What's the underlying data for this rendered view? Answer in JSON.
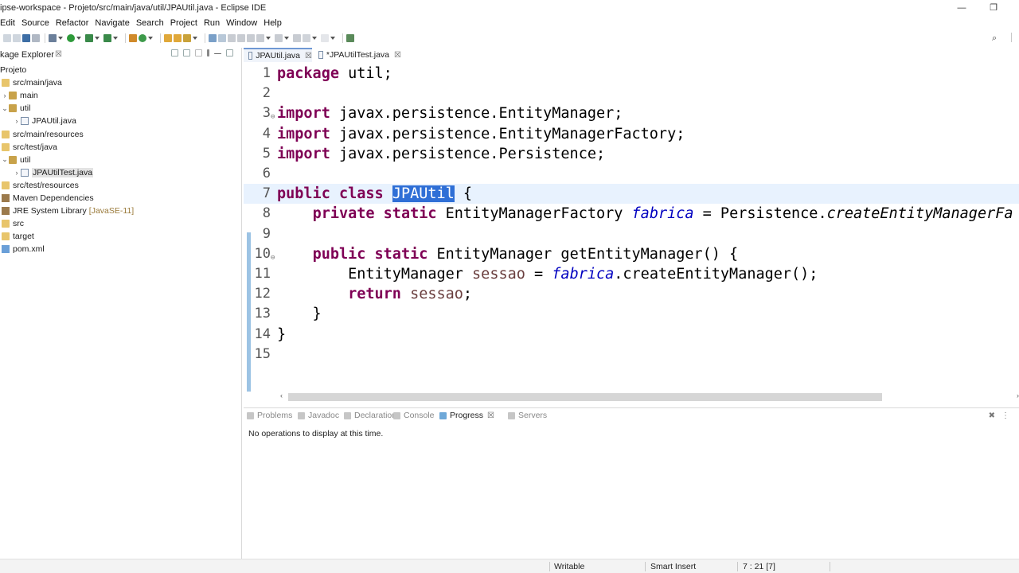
{
  "window": {
    "title": "ipse-workspace - Projeto/src/main/java/util/JPAUtil.java - Eclipse IDE",
    "minimize": "—",
    "restore": "❐"
  },
  "menu": [
    "Edit",
    "Source",
    "Refactor",
    "Navigate",
    "Search",
    "Project",
    "Run",
    "Window",
    "Help"
  ],
  "package_explorer": {
    "title": "kage Explorer",
    "close": "☒",
    "tree": [
      {
        "label": "Projeto",
        "indent": 0,
        "twisty": "",
        "icon": "proj"
      },
      {
        "label": "src/main/java",
        "indent": 1,
        "twisty": "",
        "icon": "folder"
      },
      {
        "label": "main",
        "indent": 2,
        "twisty": "›",
        "icon": "pkg"
      },
      {
        "label": "util",
        "indent": 2,
        "twisty": "⌄",
        "icon": "pkg"
      },
      {
        "label": "JPAUtil.java",
        "indent": 3,
        "twisty": "›",
        "icon": "java"
      },
      {
        "label": "src/main/resources",
        "indent": 1,
        "twisty": "",
        "icon": "folder"
      },
      {
        "label": "src/test/java",
        "indent": 1,
        "twisty": "",
        "icon": "folder"
      },
      {
        "label": "util",
        "indent": 2,
        "twisty": "⌄",
        "icon": "pkg"
      },
      {
        "label": "JPAUtilTest.java",
        "indent": 3,
        "twisty": "›",
        "icon": "java",
        "selected": true
      },
      {
        "label": "src/test/resources",
        "indent": 1,
        "twisty": "",
        "icon": "folder"
      },
      {
        "label": "Maven Dependencies",
        "indent": 1,
        "twisty": "",
        "icon": "lib"
      },
      {
        "label": "JRE System Library",
        "suffix": "[JavaSE-11]",
        "indent": 1,
        "twisty": "",
        "icon": "lib"
      },
      {
        "label": "src",
        "indent": 1,
        "twisty": "",
        "icon": "folder"
      },
      {
        "label": "target",
        "indent": 1,
        "twisty": "",
        "icon": "folder"
      },
      {
        "label": "pom.xml",
        "indent": 1,
        "twisty": "",
        "icon": "xml"
      }
    ]
  },
  "editor": {
    "tabs": [
      {
        "label": "JPAUtil.java",
        "close": "☒",
        "active": true
      },
      {
        "label": "*JPAUtilTest.java",
        "close": "☒",
        "active": false
      }
    ],
    "current_line": 7,
    "selection": "JPAUtil",
    "lines": [
      {
        "n": "1",
        "code": "package util;"
      },
      {
        "n": "2",
        "code": ""
      },
      {
        "n": "3",
        "code": "import javax.persistence.EntityManager;",
        "fold": true
      },
      {
        "n": "4",
        "code": "import javax.persistence.EntityManagerFactory;"
      },
      {
        "n": "5",
        "code": "import javax.persistence.Persistence;"
      },
      {
        "n": "6",
        "code": ""
      },
      {
        "n": "7",
        "code": "public class JPAUtil {"
      },
      {
        "n": "8",
        "code": "    private static EntityManagerFactory fabrica = Persistence.createEntityManagerFa"
      },
      {
        "n": "9",
        "code": ""
      },
      {
        "n": "10",
        "code": "    public static EntityManager getEntityManager() {",
        "fold": true
      },
      {
        "n": "11",
        "code": "        EntityManager sessao = fabrica.createEntityManager();"
      },
      {
        "n": "12",
        "code": "        return sessao;"
      },
      {
        "n": "13",
        "code": "    }"
      },
      {
        "n": "14",
        "code": "}"
      },
      {
        "n": "15",
        "code": ""
      }
    ]
  },
  "bottom_panel": {
    "tabs": [
      {
        "label": "Problems",
        "active": false
      },
      {
        "label": "Javadoc",
        "active": false
      },
      {
        "label": "Declaration",
        "active": false
      },
      {
        "label": "Console",
        "active": false
      },
      {
        "label": "Progress",
        "active": true,
        "close": "☒"
      },
      {
        "label": "Servers",
        "active": false
      }
    ],
    "message": "No operations to display at this time."
  },
  "status": {
    "writable": "Writable",
    "insert_mode": "Smart Insert",
    "position": "7 : 21 [7]"
  },
  "colors": {
    "keyword": "#7f0055",
    "field": "#0000c0",
    "local_var": "#6a3e3e",
    "selection": "#2f6fd6",
    "current_line": "#e8f2fe"
  }
}
